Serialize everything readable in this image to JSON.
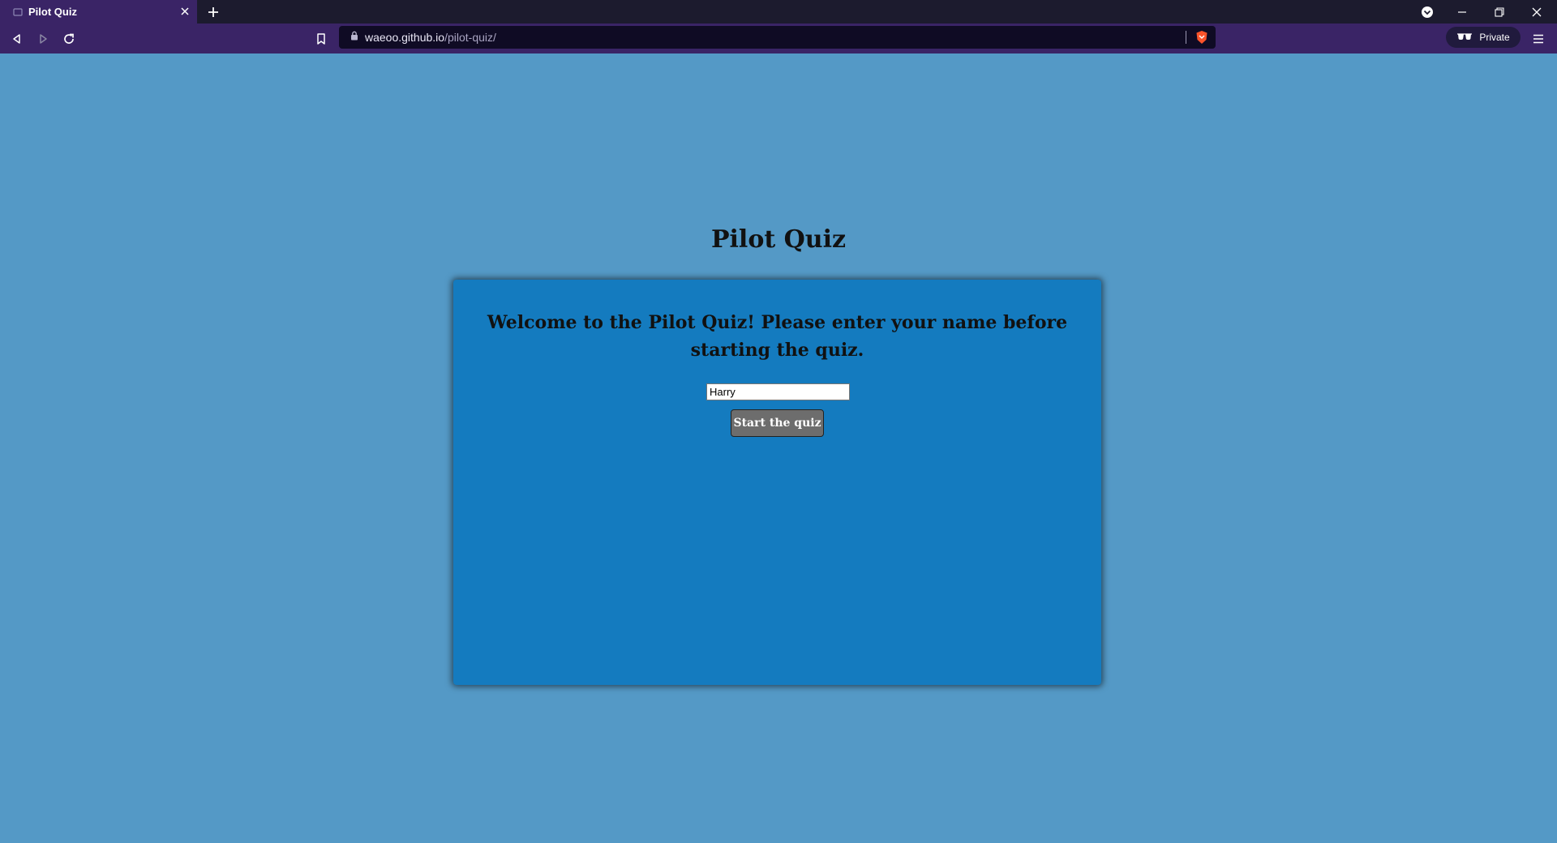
{
  "browser": {
    "tab": {
      "title": "Pilot Quiz"
    },
    "url": {
      "host": "waeoo.github.io",
      "path": "/pilot-quiz/"
    },
    "private_label": "Private"
  },
  "page": {
    "title": "Pilot Quiz",
    "welcome_text": "Welcome to the Pilot Quiz! Please enter your name before starting the quiz.",
    "name_input": {
      "value": "Harry"
    },
    "start_button_label": "Start the quiz"
  },
  "colors": {
    "page_background": "#5499c6",
    "card_background": "#147bbf",
    "browser_toolbar": "#3a2466",
    "button_background": "#6d6d6d"
  },
  "icons": {
    "tab_favicon": "page-icon",
    "tab_close": "close-icon",
    "new_tab": "plus-icon",
    "back": "back-arrow-icon",
    "forward": "forward-arrow-icon",
    "reload": "reload-icon",
    "bookmark": "bookmark-icon",
    "lock": "lock-icon",
    "brave_shield": "brave-shield-icon",
    "private": "private-glasses-icon",
    "menu": "hamburger-menu-icon"
  }
}
